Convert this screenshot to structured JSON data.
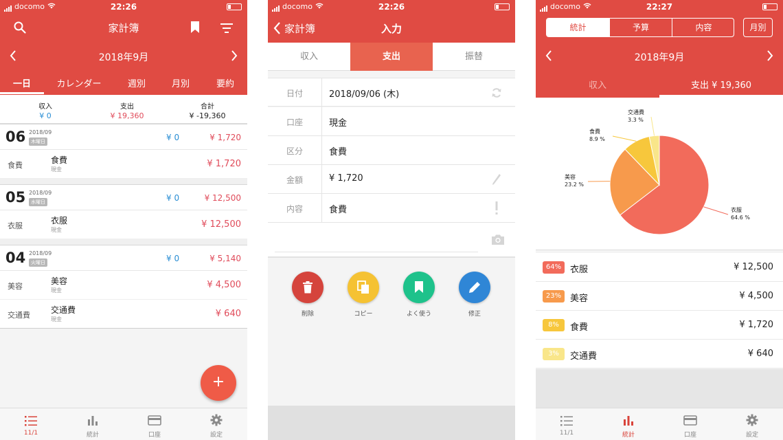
{
  "status": {
    "carrier": "docomo",
    "time1": "22:26",
    "time2": "22:26",
    "time3": "22:27"
  },
  "screen1": {
    "title": "家計簿",
    "month": "2018年9月",
    "tabs": [
      "一日",
      "カレンダー",
      "週別",
      "月別",
      "要約"
    ],
    "summary": {
      "income_label": "収入",
      "income_value": "¥ 0",
      "expense_label": "支出",
      "expense_value": "¥ 19,360",
      "total_label": "合計",
      "total_value": "¥ -19,360"
    },
    "days": [
      {
        "day": "06",
        "ym": "2018/09",
        "week": "木曜日",
        "income": "¥ 0",
        "expense": "¥ 1,720",
        "entries": [
          {
            "cat": "食費",
            "name": "食費",
            "sub": "現金",
            "amount": "¥ 1,720"
          }
        ]
      },
      {
        "day": "05",
        "ym": "2018/09",
        "week": "水曜日",
        "income": "¥ 0",
        "expense": "¥ 12,500",
        "entries": [
          {
            "cat": "衣服",
            "name": "衣服",
            "sub": "現金",
            "amount": "¥ 12,500"
          }
        ]
      },
      {
        "day": "04",
        "ym": "2018/09",
        "week": "火曜日",
        "income": "¥ 0",
        "expense": "¥ 5,140",
        "entries": [
          {
            "cat": "美容",
            "name": "美容",
            "sub": "現金",
            "amount": "¥ 4,500"
          },
          {
            "cat": "交通費",
            "name": "交通費",
            "sub": "現金",
            "amount": "¥ 640"
          }
        ]
      }
    ],
    "fab": "+",
    "tabbar": [
      "11/1",
      "統計",
      "口座",
      "設定"
    ]
  },
  "screen2": {
    "back": "家計簿",
    "title": "入力",
    "segments": [
      "収入",
      "支出",
      "振替"
    ],
    "form": [
      {
        "key": "日付",
        "value": "2018/09/06 (木)"
      },
      {
        "key": "口座",
        "value": "現金"
      },
      {
        "key": "区分",
        "value": "食費"
      },
      {
        "key": "金額",
        "value": "¥ 1,720"
      },
      {
        "key": "内容",
        "value": "食費"
      }
    ],
    "actions": [
      "削除",
      "コピー",
      "よく使う",
      "修正"
    ]
  },
  "screen3": {
    "segments": [
      "統計",
      "予算",
      "内容"
    ],
    "period_button": "月別",
    "month": "2018年9月",
    "tabs": [
      "収入",
      "支出 ¥ 19,360"
    ],
    "tabbar": [
      "11/1",
      "統計",
      "口座",
      "設定"
    ],
    "chart_data": {
      "type": "pie",
      "slices": [
        {
          "label": "衣服",
          "percent": 64.6,
          "percent_label": "64.6 %",
          "color": "#f26b5b"
        },
        {
          "label": "美容",
          "percent": 23.2,
          "percent_label": "23.2 %",
          "color": "#f79a4c"
        },
        {
          "label": "食費",
          "percent": 8.9,
          "percent_label": "8.9 %",
          "color": "#f7c73c"
        },
        {
          "label": "交通費",
          "percent": 3.3,
          "percent_label": "3.3 %",
          "color": "#f9e68a"
        }
      ]
    },
    "legend": [
      {
        "pct": "64%",
        "name": "衣服",
        "amount": "¥ 12,500",
        "color": "#f26b5b"
      },
      {
        "pct": "23%",
        "name": "美容",
        "amount": "¥ 4,500",
        "color": "#f79a4c"
      },
      {
        "pct": "8%",
        "name": "食費",
        "amount": "¥ 1,720",
        "color": "#f7c73c"
      },
      {
        "pct": "3%",
        "name": "交通費",
        "amount": "¥ 640",
        "color": "#f9e68a"
      }
    ]
  },
  "colors": {
    "accent": "#e04b43",
    "expense": "#e04b5a",
    "income": "#2a8ed4"
  }
}
